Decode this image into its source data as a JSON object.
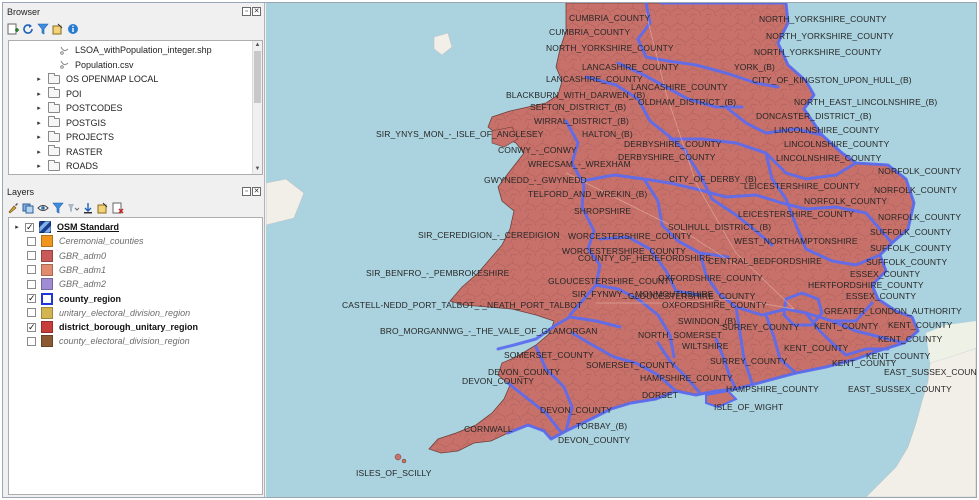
{
  "browser": {
    "title": "Browser",
    "items": [
      {
        "label": "LSOA_withPopulation_integer.shp",
        "kind": "file"
      },
      {
        "label": "Population.csv",
        "kind": "file"
      },
      {
        "label": "OS OPENMAP LOCAL",
        "kind": "folder"
      },
      {
        "label": "POI",
        "kind": "folder"
      },
      {
        "label": "POSTCODES",
        "kind": "folder"
      },
      {
        "label": "POSTGIS",
        "kind": "folder"
      },
      {
        "label": "PROJECTS",
        "kind": "folder"
      },
      {
        "label": "RASTER",
        "kind": "folder"
      },
      {
        "label": "ROADS",
        "kind": "folder"
      }
    ]
  },
  "layers": {
    "title": "Layers",
    "items": [
      {
        "label": "OSM Standard",
        "checked": true,
        "style": "bold-underline",
        "swatch": "osm"
      },
      {
        "label": "Ceremonial_counties",
        "checked": false,
        "style": "dim",
        "swatch": "#f0961e"
      },
      {
        "label": "GBR_adm0",
        "checked": false,
        "style": "dim",
        "swatch": "#c85a5a"
      },
      {
        "label": "GBR_adm1",
        "checked": false,
        "style": "dim",
        "swatch": "#e08a6e"
      },
      {
        "label": "GBR_adm2",
        "checked": false,
        "style": "dim",
        "swatch": "#a08cd2"
      },
      {
        "label": "county_region",
        "checked": true,
        "style": "bold",
        "swatch": "outline-blue"
      },
      {
        "label": "unitary_electoral_division_region",
        "checked": false,
        "style": "dim",
        "swatch": "#d2b450"
      },
      {
        "label": "district_borough_unitary_region",
        "checked": true,
        "style": "bold",
        "swatch": "#c83c3c"
      },
      {
        "label": "county_electoral_division_region",
        "checked": false,
        "style": "dim",
        "swatch": "#8c5a32"
      }
    ]
  },
  "colors": {
    "land": "#c8716a",
    "land_outline": "#6f3f3a",
    "county_boundary": "#5b6cf0",
    "sea": "#aad3df",
    "europe_land": "#f2efe9",
    "text": "#262626"
  },
  "map": {
    "labels": [
      "CUMBRIA_COUNTY",
      "CUMBRIA_COUNTY",
      "NORTH_YORKSHIRE_COUNTY",
      "NORTH_YORKSHIRE_COUNTY",
      "NORTH_YORKSHIRE_COUNTY",
      "NORTH_YORKSHIRE_COUNTY",
      "LANCASHIRE_COUNTY",
      "LANCASHIRE_COUNTY",
      "YORK_(B)",
      "LANCASHIRE_COUNTY",
      "CITY_OF_KINGSTON_UPON_HULL_(B)",
      "BLACKBURN_WITH_DARWEN_(B)",
      "OLDHAM_DISTRICT_(B)",
      "NORTH_EAST_LINCOLNSHIRE_(B)",
      "SEFTON_DISTRICT_(B)",
      "DONCASTER_DISTRICT_(B)",
      "WIRRAL_DISTRICT_(B)",
      "LINCOLNSHIRE_COUNTY",
      "SIR_YNYS_MON_-_ISLE_OF_ANGLESEY",
      "HALTON_(B)",
      "DERBYSHIRE_COUNTY",
      "LINCOLNSHIRE_COUNTY",
      "CONWY_-_CONWY",
      "DERBYSHIRE_COUNTY",
      "LINCOLNSHIRE_COUNTY",
      "WRECSAM_-_WREXHAM",
      "NORFOLK_COUNTY",
      "GWYNEDD_-_GWYNEDD",
      "CITY_OF_DERBY_(B)",
      "LEICESTERSHIRE_COUNTY",
      "NORFOLK_COUNTY",
      "TELFORD_AND_WREKIN_(B)",
      "NORFOLK_COUNTY",
      "SHROPSHIRE",
      "LEICESTERSHIRE_COUNTY",
      "NORFOLK_COUNTY",
      "SOLIHULL_DISTRICT_(B)",
      "SIR_CEREDIGION_-_CEREDIGION",
      "WORCESTERSHIRE_COUNTY",
      "SUFFOLK_COUNTY",
      "WEST_NORTHAMPTONSHIRE",
      "SUFFOLK_COUNTY",
      "WORCESTERSHIRE_COUNTY",
      "SUFFOLK_COUNTY",
      "COUNTY_OF_HEREFORDSHIRE",
      "CENTRAL_BEDFORDSHIRE",
      "SIR_BENFRO_-_PEMBROKESHIRE",
      "ESSEX_COUNTY",
      "GLOUCESTERSHIRE_COUNTY",
      "OXFORDSHIRE_COUNTY",
      "HERTFORDSHIRE_COUNTY",
      "SIR_FYNWY_-_MONMOUTHSHIRE",
      "GLOUCESTERSHIRE_COUNTY",
      "ESSEX_COUNTY",
      "CASTELL-NEDD_PORT_TALBOT_-_NEATH_PORT_TALBOT",
      "OXFORDSHIRE_COUNTY",
      "GREATER_LONDON_AUTHORITY",
      "SWINDON_(B)",
      "KENT_COUNTY",
      "KENT_COUNTY",
      "BRO_MORGANNWG_-_THE_VALE_OF_GLAMORGAN",
      "SURREY_COUNTY",
      "NORTH_SOMERSET",
      "KENT_COUNTY",
      "KENT_COUNTY",
      "WILTSHIRE",
      "KENT_COUNTY",
      "SOMERSET_COUNTY",
      "SURREY_COUNTY",
      "KENT_COUNTY",
      "DEVON_COUNTY",
      "SOMERSET_COUNTY",
      "EAST_SUSSEX_COUNTY",
      "DEVON_COUNTY",
      "HAMPSHIRE_COUNTY",
      "EAST_SUSSEX_COUNTY",
      "HAMPSHIRE_COUNTY",
      "DORSET",
      "ISLE_OF_WIGHT",
      "DEVON_COUNTY",
      "CORNWALL",
      "TORBAY_(B)",
      "DEVON_COUNTY",
      "ISLES_OF_SCILLY"
    ]
  }
}
